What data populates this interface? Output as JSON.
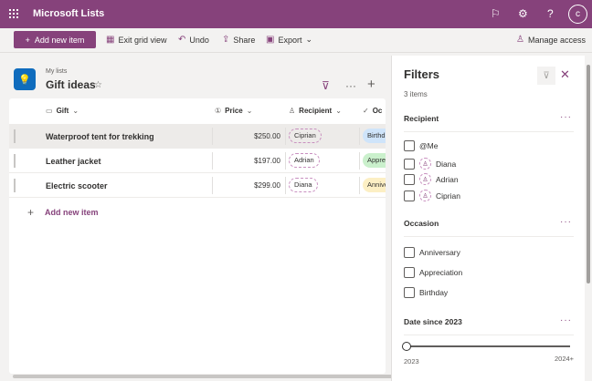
{
  "app": {
    "title": "Microsoft Lists",
    "avatar": "c"
  },
  "toolbar": {
    "add": "Add new item",
    "exit_grid": "Exit grid view",
    "undo": "Undo",
    "share": "Share",
    "export": "Export",
    "manage_access": "Manage access"
  },
  "list": {
    "breadcrumb": "My lists",
    "title": "Gift ideas"
  },
  "columns": {
    "gift": "Gift",
    "price": "Price",
    "recipient": "Recipient",
    "occasion": "Oc"
  },
  "rows": [
    {
      "gift": "Waterproof tent for trekking",
      "price": "$250.00",
      "recipient": "Ciprian",
      "occasion": "Birthday",
      "occ_color": "#cfe4fa"
    },
    {
      "gift": "Leather jacket",
      "price": "$197.00",
      "recipient": "Adrian",
      "occasion": "Appreciation",
      "occ_color": "#caf0cc"
    },
    {
      "gift": "Electric scooter",
      "price": "$299.00",
      "recipient": "Diana",
      "occasion": "Anniversary",
      "occ_color": "#fcefc4"
    }
  ],
  "add_row": "Add new item",
  "filters": {
    "title": "Filters",
    "count": "3 items",
    "recipient": {
      "title": "Recipient",
      "options": [
        "@Me",
        "Diana",
        "Adrian",
        "Ciprian"
      ]
    },
    "occasion": {
      "title": "Occasion",
      "options": [
        "Anniversary",
        "Appreciation",
        "Birthday"
      ]
    },
    "date": {
      "title": "Date since 2023",
      "min": "2023",
      "max": "2024+",
      "value_fraction": 0
    }
  },
  "colors": {
    "brand": "#86427b"
  }
}
